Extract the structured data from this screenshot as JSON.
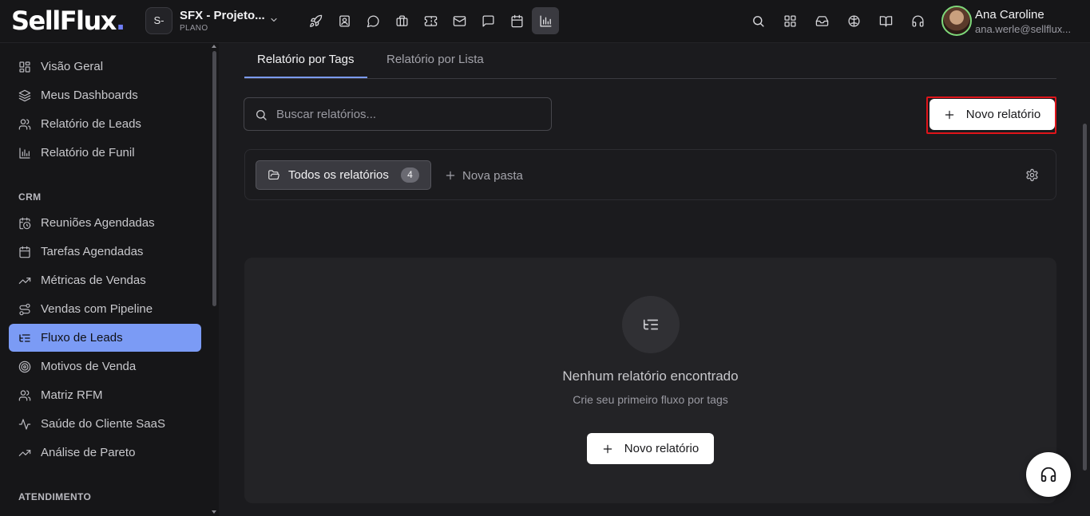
{
  "brand": {
    "logo_text": "SellFlux",
    "logo_dot": ".",
    "accent_color": "#7b9bf5"
  },
  "project": {
    "avatar_text": "S-",
    "name": "SFX - Projeto...",
    "plan": "PLANO"
  },
  "topnav_icons": [
    "rocket-icon",
    "contact-book-icon",
    "chat-bubble-icon",
    "briefcase-icon",
    "ticket-icon",
    "mail-icon",
    "message-square-icon",
    "calendar-icon",
    "bar-chart-icon"
  ],
  "top_right_icons": [
    "search-icon",
    "apps-grid-icon",
    "inbox-icon",
    "brain-icon",
    "book-open-icon",
    "headset-icon"
  ],
  "user": {
    "name": "Ana Caroline",
    "email": "ana.werle@sellflux..."
  },
  "sidebar": {
    "group1": [
      {
        "label": "Visão Geral",
        "icon": "layout-grid-icon"
      },
      {
        "label": "Meus Dashboards",
        "icon": "layers-icon"
      },
      {
        "label": "Relatório de Leads",
        "icon": "users-icon"
      },
      {
        "label": "Relatório de Funil",
        "icon": "bar-chart-icon"
      }
    ],
    "section_crm": "CRM",
    "crm": [
      {
        "label": "Reuniões Agendadas",
        "icon": "calendar-clock-icon"
      },
      {
        "label": "Tarefas Agendadas",
        "icon": "calendar-icon"
      },
      {
        "label": "Métricas de Vendas",
        "icon": "trending-up-icon"
      },
      {
        "label": "Vendas com Pipeline",
        "icon": "route-icon"
      },
      {
        "label": "Fluxo de Leads",
        "icon": "list-tree-icon",
        "active": true
      },
      {
        "label": "Motivos de Venda",
        "icon": "target-icon"
      },
      {
        "label": "Matriz RFM",
        "icon": "users-icon"
      },
      {
        "label": "Saúde do Cliente SaaS",
        "icon": "activity-icon"
      },
      {
        "label": "Análise de Pareto",
        "icon": "trending-up-icon"
      }
    ],
    "section_atendimento": "ATENDIMENTO"
  },
  "tabs": [
    {
      "label": "Relatório por Tags",
      "active": true
    },
    {
      "label": "Relatório por Lista",
      "active": false
    }
  ],
  "search": {
    "placeholder": "Buscar relatórios..."
  },
  "new_report_label": "Novo relatório",
  "folders": {
    "all_label": "Todos os relatórios",
    "all_count": "4",
    "new_folder_label": "Nova pasta"
  },
  "empty_state": {
    "title": "Nenhum relatório encontrado",
    "subtitle": "Crie seu primeiro fluxo por tags",
    "button_label": "Novo relatório"
  }
}
